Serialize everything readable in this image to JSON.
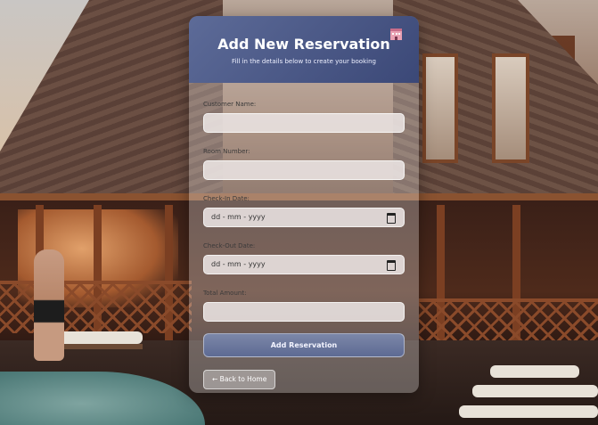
{
  "form": {
    "title": "Add New Reservation",
    "subtitle": "Fill in the details below to create your booking",
    "icon": "hotel-icon",
    "fields": {
      "customer_name": {
        "label": "Customer Name:",
        "value": ""
      },
      "room_number": {
        "label": "Room Number:",
        "value": ""
      },
      "check_in": {
        "label": "Check-In Date:",
        "value": "dd - mm - yyyy"
      },
      "check_out": {
        "label": "Check-Out Date:",
        "value": "dd - mm - yyyy"
      },
      "total_amount": {
        "label": "Total Amount:",
        "value": ""
      }
    },
    "submit_label": "Add Reservation",
    "back_label": "← Back to Home"
  },
  "colors": {
    "header_start": "#5d6b98",
    "header_end": "#3b4877",
    "button": "#6b769d"
  }
}
